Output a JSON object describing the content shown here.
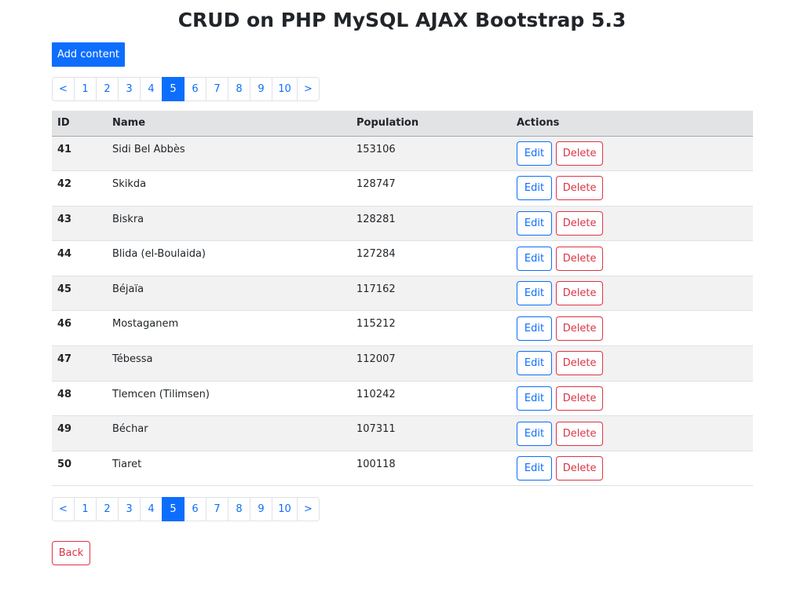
{
  "header": {
    "title": "CRUD on PHP MySQL AJAX Bootstrap 5.3"
  },
  "toolbar": {
    "add_label": "Add content"
  },
  "pagination": {
    "prev_label": "<",
    "next_label": ">",
    "pages": [
      "1",
      "2",
      "3",
      "4",
      "5",
      "6",
      "7",
      "8",
      "9",
      "10"
    ],
    "active_page": "5"
  },
  "table": {
    "columns": {
      "id": "ID",
      "name": "Name",
      "population": "Population",
      "actions": "Actions"
    },
    "rows": [
      {
        "id": "41",
        "name": "Sidi Bel Abbès",
        "population": "153106"
      },
      {
        "id": "42",
        "name": "Skikda",
        "population": "128747"
      },
      {
        "id": "43",
        "name": "Biskra",
        "population": "128281"
      },
      {
        "id": "44",
        "name": "Blida (el-Boulaida)",
        "population": "127284"
      },
      {
        "id": "45",
        "name": "Béjaïa",
        "population": "117162"
      },
      {
        "id": "46",
        "name": "Mostaganem",
        "population": "115212"
      },
      {
        "id": "47",
        "name": "Tébessa",
        "population": "112007"
      },
      {
        "id": "48",
        "name": "Tlemcen (Tilimsen)",
        "population": "110242"
      },
      {
        "id": "49",
        "name": "Béchar",
        "population": "107311"
      },
      {
        "id": "50",
        "name": "Tiaret",
        "population": "100118"
      }
    ],
    "edit_label": "Edit",
    "delete_label": "Delete"
  },
  "footer": {
    "back_label": "Back"
  },
  "colors": {
    "primary": "#0d6efd",
    "danger": "#dc3545",
    "header_bg": "#e2e3e5",
    "stripe_bg": "#f2f2f2"
  }
}
